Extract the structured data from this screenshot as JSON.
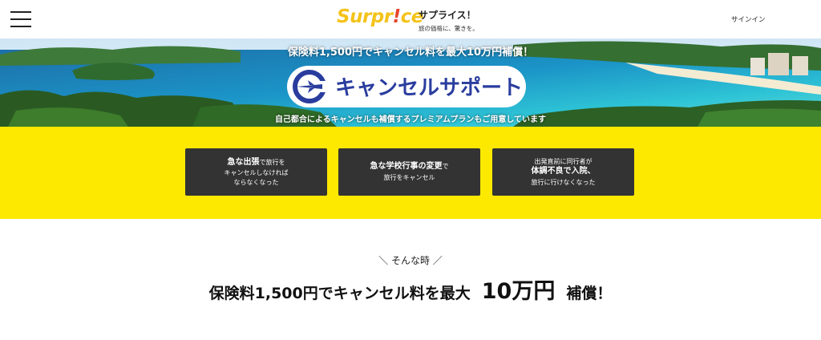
{
  "header": {
    "menu_icon": "hamburger-menu-icon",
    "logo_part1": "Surpr",
    "logo_bang": "!",
    "logo_part2": "ce",
    "brand_name": "サプライス！",
    "brand_tagline": "旅の価格に、驚きを。",
    "signin_label": "サインイン"
  },
  "hero": {
    "headline": "保険料1,500円でキャンセル料を最大10万円補償！",
    "logo_text": "キャンセルサポート",
    "logo_icon": "airplane-icon",
    "subline": "自己都合によるキャンセルも補償するプレミアムプランもご用意しています"
  },
  "cases": [
    {
      "bold": "急な出張",
      "rest1": "で旅行を",
      "line2": "キャンセルしなければ",
      "line3": "ならなくなった"
    },
    {
      "bold": "急な学校行事の変更",
      "rest1": "で",
      "line2": "旅行をキャンセル",
      "line3": ""
    },
    {
      "line1": "出発直前に同行者が",
      "bold": "体調不良で入院、",
      "line3": "旅行に行けなくなった"
    }
  ],
  "bottom": {
    "lead": "＼ そんな時 ／",
    "headline_pre": "保険料1,500円でキャンセル料を最大",
    "headline_amount": "10万円",
    "headline_post": "補償！"
  },
  "colors": {
    "accent_yellow": "#fde800",
    "logo_yellow": "#f4c31a",
    "logo_red": "#e8452c",
    "card_dark": "#333333",
    "support_blue": "#2a3d9e"
  }
}
